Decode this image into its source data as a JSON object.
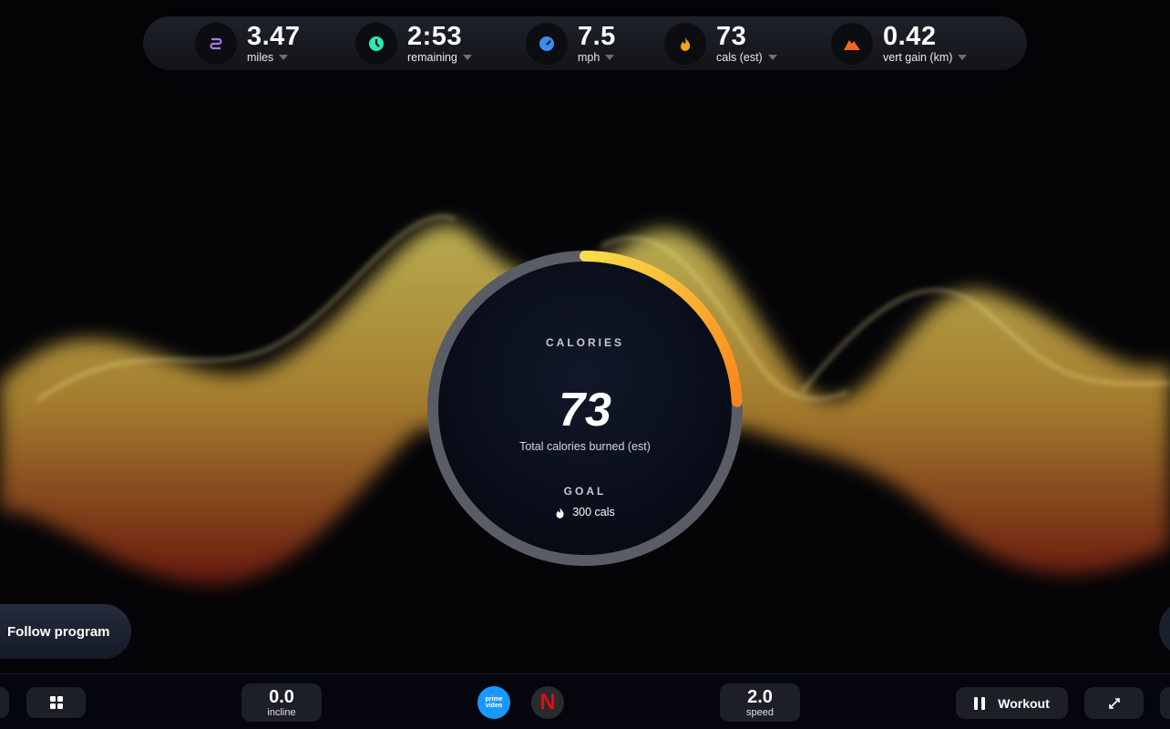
{
  "stats": [
    {
      "value": "3.47",
      "label": "miles",
      "icon": "route-icon",
      "color": "#a77bf3"
    },
    {
      "value": "2:53",
      "label": "remaining",
      "icon": "clock-icon",
      "color": "#2ee8b0"
    },
    {
      "value": "7.5",
      "label": "mph",
      "icon": "speedometer-icon",
      "color": "#3b8cf0"
    },
    {
      "value": "73",
      "label": "cals (est)",
      "icon": "flame-icon",
      "color": "#f7a21b"
    },
    {
      "value": "0.42",
      "label": "vert gain (km)",
      "icon": "mountain-icon",
      "color": "#f7631b"
    }
  ],
  "calories": {
    "title": "CALORIES",
    "value": "73",
    "subtitle": "Total calories burned (est)",
    "goal_title": "GOAL",
    "goal_value": "300 cals",
    "progress": 0.243
  },
  "follow_program": "Follow program",
  "bottom": {
    "incline_value": "0.0",
    "incline_label": "incline",
    "speed_value": "2.0",
    "speed_label": "speed",
    "workout_label": "Workout",
    "prime_label": "prime video",
    "netflix_label": "N"
  }
}
